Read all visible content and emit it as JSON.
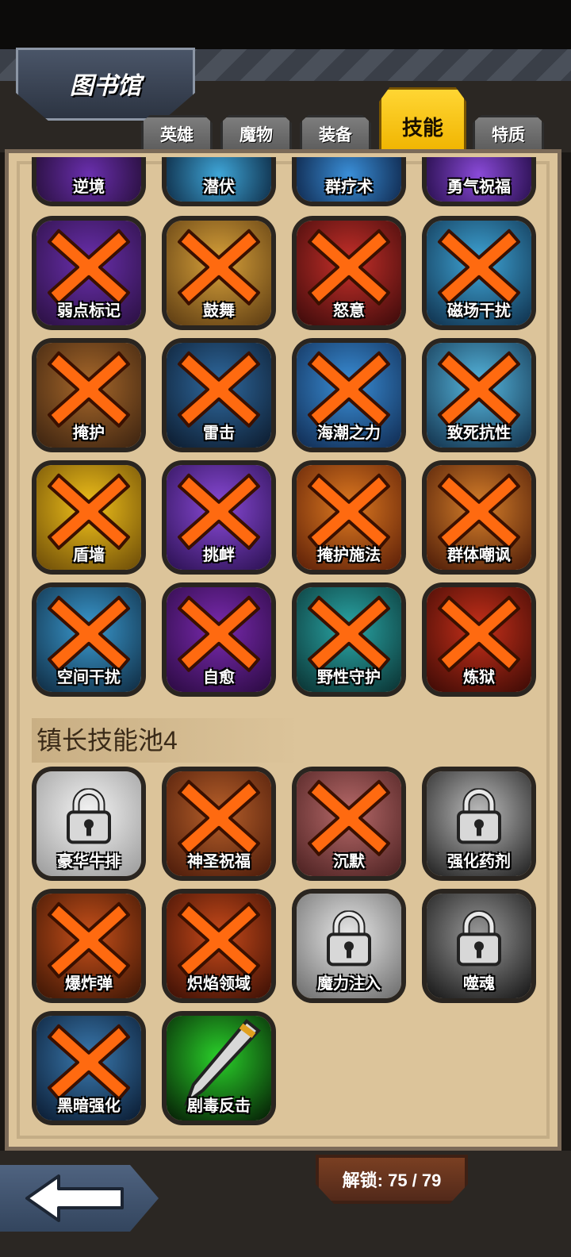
{
  "header": {
    "title": "图书馆"
  },
  "tabs": [
    {
      "label": "英雄",
      "active": false
    },
    {
      "label": "魔物",
      "active": false
    },
    {
      "label": "装备",
      "active": false
    },
    {
      "label": "技能",
      "active": true
    },
    {
      "label": "特质",
      "active": false
    }
  ],
  "skills_top_partial": [
    "逆境",
    "潜伏",
    "群疗术",
    "勇气祝福"
  ],
  "skills_grid": [
    {
      "label": "弱点标记",
      "state": "crossed"
    },
    {
      "label": "鼓舞",
      "state": "crossed"
    },
    {
      "label": "怒意",
      "state": "crossed"
    },
    {
      "label": "磁场干扰",
      "state": "crossed"
    },
    {
      "label": "掩护",
      "state": "crossed"
    },
    {
      "label": "雷击",
      "state": "crossed"
    },
    {
      "label": "海潮之力",
      "state": "crossed"
    },
    {
      "label": "致死抗性",
      "state": "crossed"
    },
    {
      "label": "盾墙",
      "state": "crossed"
    },
    {
      "label": "挑衅",
      "state": "crossed"
    },
    {
      "label": "掩护施法",
      "state": "crossed"
    },
    {
      "label": "群体嘲讽",
      "state": "crossed"
    },
    {
      "label": "空间干扰",
      "state": "crossed"
    },
    {
      "label": "自愈",
      "state": "crossed"
    },
    {
      "label": "野性守护",
      "state": "crossed"
    },
    {
      "label": "炼狱",
      "state": "crossed"
    }
  ],
  "pool4": {
    "title": "镇长技能池4",
    "skills": [
      {
        "label": "豪华牛排",
        "state": "locked"
      },
      {
        "label": "神圣祝福",
        "state": "crossed"
      },
      {
        "label": "沉默",
        "state": "crossed"
      },
      {
        "label": "强化药剂",
        "state": "locked"
      },
      {
        "label": "爆炸弹",
        "state": "crossed"
      },
      {
        "label": "炽焰领域",
        "state": "crossed"
      },
      {
        "label": "魔力注入",
        "state": "locked"
      },
      {
        "label": "噬魂",
        "state": "locked"
      },
      {
        "label": "黑暗强化",
        "state": "crossed"
      },
      {
        "label": "剧毒反击",
        "state": "unlocked"
      }
    ]
  },
  "footer": {
    "unlock_text": "解锁: 75 / 79"
  },
  "colors": {
    "cross": "#ff6a10",
    "active_tab": "#f5c000",
    "panel": "#dcc49a"
  }
}
